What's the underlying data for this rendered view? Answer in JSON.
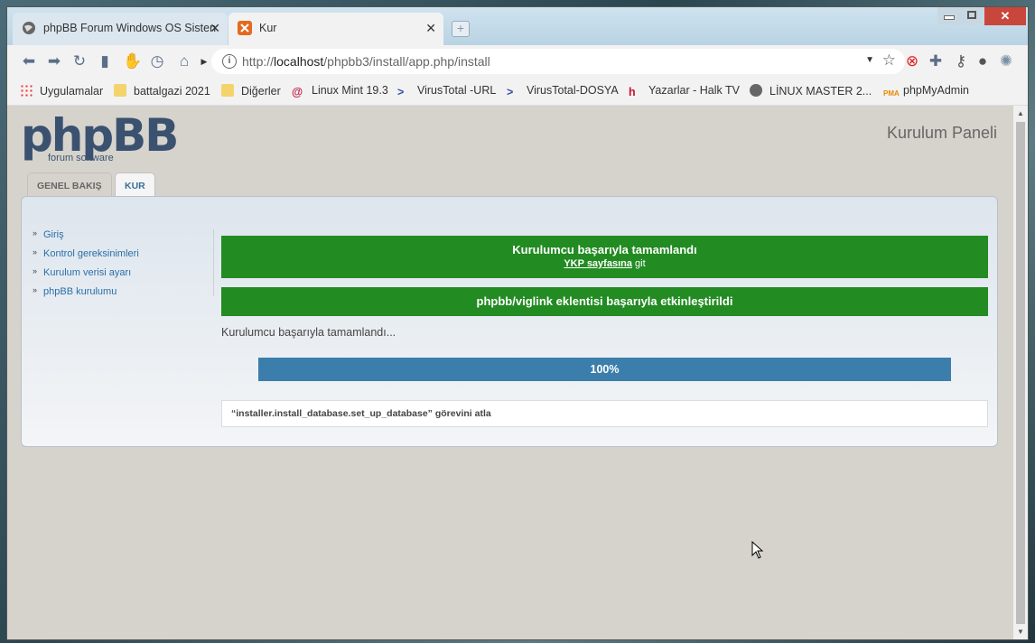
{
  "browser": {
    "tabs": [
      {
        "title": "phpBB Forum Windows OS Sisten",
        "active": false
      },
      {
        "title": "Kur",
        "active": true
      }
    ],
    "address": {
      "host": "localhost",
      "path": "/phpbb3/install/app.php/install",
      "prefix": "http://"
    },
    "bookmarks": [
      {
        "label": "Uygulamalar",
        "icon": "apps-grid-icon"
      },
      {
        "label": "battalgazi 2021",
        "icon": "folder-icon"
      },
      {
        "label": "Diğerler",
        "icon": "folder-icon"
      },
      {
        "label": "Linux Mint 19.3",
        "icon": "debian-swirl-icon"
      },
      {
        "label": "VirusTotal -URL",
        "icon": "virustotal-icon"
      },
      {
        "label": "VirusTotal-DOSYA",
        "icon": "virustotal-icon"
      },
      {
        "label": "Yazarlar - Halk TV",
        "icon": "halktv-icon"
      },
      {
        "label": "LİNUX MASTER 2...",
        "icon": "globe-icon"
      },
      {
        "label": "phpMyAdmin",
        "icon": "pma-icon"
      }
    ]
  },
  "page": {
    "logo": {
      "word": "phpBB",
      "sub": "forum software"
    },
    "panel_title": "Kurulum Paneli",
    "tabs": [
      {
        "label": "GENEL BAKIŞ",
        "active": false
      },
      {
        "label": "KUR",
        "active": true
      }
    ],
    "menu": [
      "Giriş",
      "Kontrol gereksinimleri",
      "Kurulum verisi ayarı",
      "phpBB kurulumu"
    ],
    "success1": {
      "heading": "Kurulumcu başarıyla tamamlandı",
      "link": "YKP sayfasına",
      "link_suffix": " git"
    },
    "success2": "phpbb/viglink eklentisi başarıyla etkinleştirildi",
    "status_text": "Kurulumcu başarıyla tamamlandı...",
    "progress": {
      "value": 100,
      "label": "100%"
    },
    "log": "“installer.install_database.set_up_database” görevini atla"
  },
  "colors": {
    "success": "#228b22",
    "progress": "#3b7eab",
    "link": "#2a6fa8"
  }
}
